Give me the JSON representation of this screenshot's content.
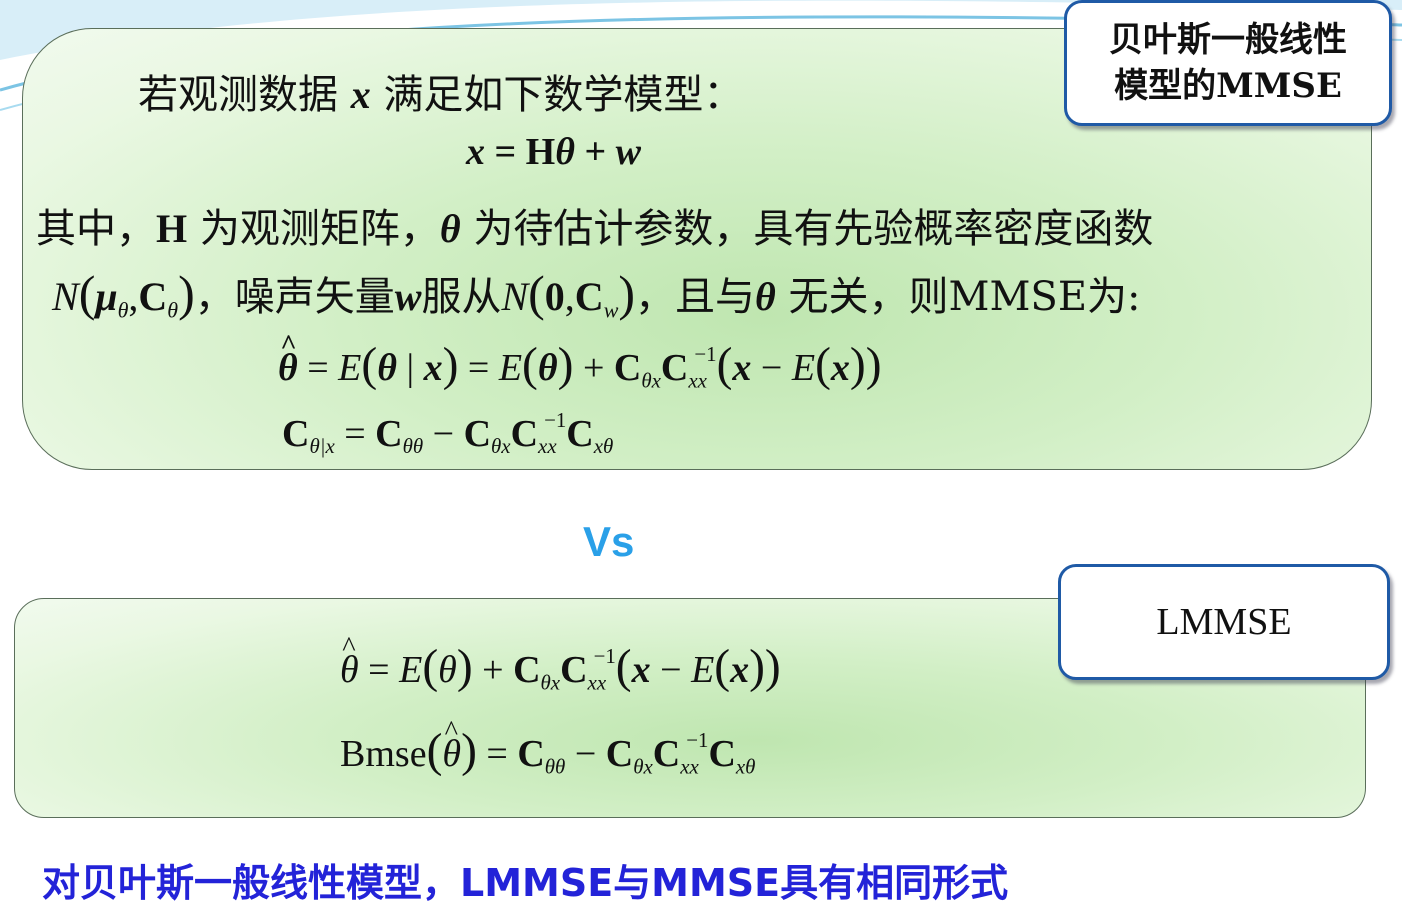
{
  "colors": {
    "panel_fill": "#c8ebbc",
    "tag_border": "#1f5aa6",
    "vs_color": "#2aa0e8",
    "conclusion_color": "#2323d8"
  },
  "tag_top": {
    "line1": "贝叶斯一般线性",
    "line2": "模型的MMSE"
  },
  "tag_bottom": {
    "label": "LMMSE"
  },
  "top_panel": {
    "intro_prefix": "若观测数据",
    "intro_var": "x",
    "intro_suffix": "满足如下数学模型：",
    "model_eq": "x = Hθ + w",
    "line3_a": "其中，",
    "line3_H": "H",
    "line3_b": "为观测矩阵，",
    "line3_theta": "θ",
    "line3_c": "为待估计参数，具有先验概率密度函数",
    "line4_prior": "N(μθ,Cθ)",
    "line4_a": "，噪声矢量",
    "line4_w": "w",
    "line4_b": "服从",
    "line4_noise": "N(0,Cw)",
    "line4_c": "，且与",
    "line4_theta": "θ",
    "line4_d": "无关，则MMSE为:"
  },
  "vs_label": "Vs",
  "bmse_label": "Bmse",
  "conclusion": "对贝叶斯一般线性模型，LMMSE与MMSE具有相同形式"
}
